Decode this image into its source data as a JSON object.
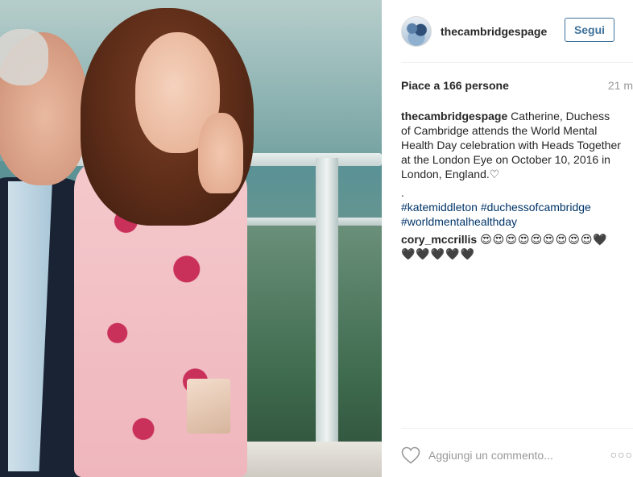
{
  "post": {
    "image_alt": "Photo of Catherine, Duchess of Cambridge waving",
    "header": {
      "username": "thecambridgespage",
      "follow_label": "Segui"
    },
    "likes_text": "Piace a 166 persone",
    "time_text": "21 m",
    "caption": {
      "username": "thecambridgespage",
      "text": " Catherine, Duchess of Cambridge attends the World Mental Health Day celebration with Heads Together at the London Eye on October 10, 2016 in London, England.♡",
      "dot": ".",
      "hashtags": [
        "#katemiddleton",
        "#duchessofcambridge",
        "#worldmentalhealthday"
      ]
    },
    "comment": {
      "username": "cory_mccrillis",
      "text": "😍😍😍😍😍😍😍😍😍🖤🖤🖤🖤🖤🖤"
    },
    "footer": {
      "add_comment_placeholder": "Aggiungi un commento...",
      "heart_icon": "heart-outline-icon",
      "more_icon": "more-options-icon",
      "more_glyph": "○○○"
    },
    "colors": {
      "follow_blue": "#3f729b",
      "hashtag_blue": "#003569",
      "muted_gray": "#999999"
    }
  }
}
